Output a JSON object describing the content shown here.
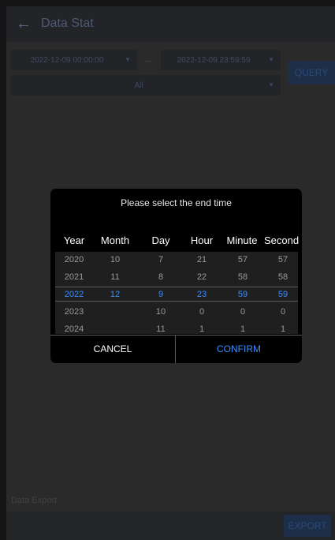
{
  "header": {
    "title": "Data Stat"
  },
  "filters": {
    "start_time": "2022-12-09 00:00:00",
    "separator": "—",
    "end_time": "2022-12-09 23:59:59",
    "category": "All",
    "query_label": "QUERY"
  },
  "export": {
    "label": "Data Export",
    "button_label": "EXPORT"
  },
  "dialog": {
    "title": "Please select the end time",
    "columns": {
      "year": {
        "label": "Year",
        "rows": [
          "2020",
          "2021",
          "2022",
          "2023",
          "2024"
        ]
      },
      "month": {
        "label": "Month",
        "rows": [
          "10",
          "11",
          "12",
          "",
          ""
        ]
      },
      "day": {
        "label": "Day",
        "rows": [
          "7",
          "8",
          "9",
          "10",
          "11"
        ]
      },
      "hour": {
        "label": "Hour",
        "rows": [
          "21",
          "22",
          "23",
          "0",
          "1"
        ]
      },
      "minute": {
        "label": "Minute",
        "rows": [
          "57",
          "58",
          "59",
          "0",
          "1"
        ]
      },
      "second": {
        "label": "Second",
        "rows": [
          "57",
          "58",
          "59",
          "0",
          "1"
        ]
      }
    },
    "cancel_label": "CANCEL",
    "confirm_label": "CONFIRM"
  },
  "colors": {
    "selected": "#3a8eff",
    "unselected": "#9a9a9a"
  }
}
